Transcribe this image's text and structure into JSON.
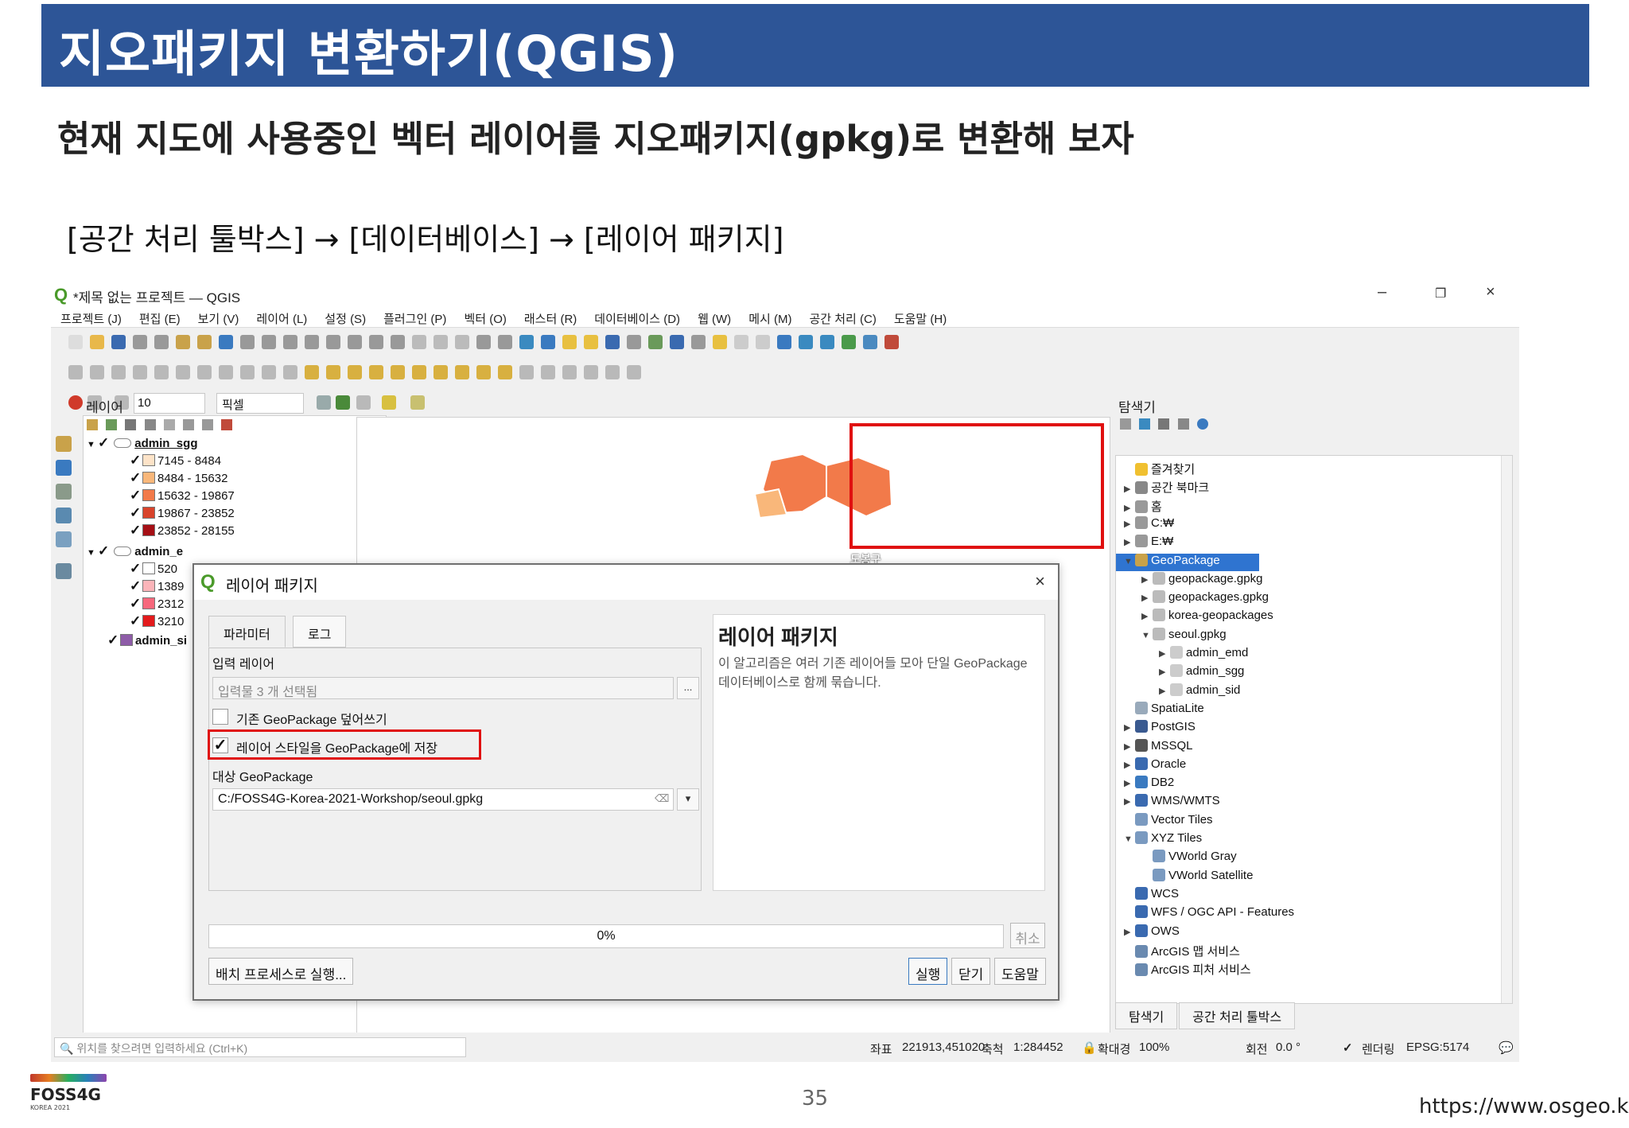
{
  "slide": {
    "title": "지오패키지 변환하기(QGIS)",
    "subtitle": "현재 지도에 사용중인 벡터 레이어를 지오패키지(gpkg)로 변환해 보자",
    "path": "[공간 처리 툴박스] → [데이터베이스] → [레이어 패키지]",
    "page_number": "35",
    "footer_url": "https://www.osgeo.kr",
    "logo_name": "FOSS4G",
    "logo_sub": "KOREA 2021"
  },
  "qgis": {
    "window_title": "*제목 없는 프로젝트 — QGIS",
    "window_controls": {
      "minimize": "–",
      "restore": "❐",
      "close": "×"
    },
    "menu": [
      "프로젝트 (J)",
      "편집 (E)",
      "보기 (V)",
      "레이어 (L)",
      "설정 (S)",
      "플러그인 (P)",
      "벡터 (O)",
      "래스터 (R)",
      "데이터베이스 (D)",
      "웹 (W)",
      "메시 (M)",
      "공간 처리 (C)",
      "도움말 (H)"
    ],
    "snapping": {
      "tolerance": "10",
      "unit": "픽셀"
    },
    "layers_panel": {
      "title": "레이어",
      "items": [
        {
          "name": "admin_sgg",
          "checked": true
        },
        {
          "label": "7145 - 8484",
          "color": "#fde3c8"
        },
        {
          "label": "8484 - 15632",
          "color": "#f9b77a"
        },
        {
          "label": "15632 - 19867",
          "color": "#f27a4a"
        },
        {
          "label": "19867 - 23852",
          "color": "#d8432b"
        },
        {
          "label": "23852 - 28155",
          "color": "#a50f15"
        },
        {
          "name": "admin_e",
          "checked": true
        },
        {
          "label": "520",
          "color": "#ffffff"
        },
        {
          "label": "1389",
          "color": "#fbb4b9"
        },
        {
          "label": "2312",
          "color": "#f7687c"
        },
        {
          "label": "3210",
          "color": "#e31a1c"
        },
        {
          "name": "admin_si",
          "checked": true,
          "color": "#8e5ca8"
        }
      ]
    },
    "map": {
      "label": "도봉구"
    },
    "browser_panel": {
      "title": "탐색기",
      "items": [
        {
          "label": "즐겨찾기",
          "icon": "star-icon"
        },
        {
          "label": "공간 북마크",
          "icon": "bookmark-icon"
        },
        {
          "label": "홈",
          "icon": "home-icon"
        },
        {
          "label": "C:₩",
          "icon": "drive-icon"
        },
        {
          "label": "E:₩",
          "icon": "drive-icon"
        },
        {
          "label": "GeoPackage",
          "icon": "geopackage-icon",
          "selected": true
        },
        {
          "label": "geopackage.gpkg",
          "icon": "database-icon"
        },
        {
          "label": "geopackages.gpkg",
          "icon": "database-icon"
        },
        {
          "label": "korea-geopackages",
          "icon": "database-icon"
        },
        {
          "label": "seoul.gpkg",
          "icon": "database-icon"
        },
        {
          "label": "admin_emd",
          "icon": "polygon-layer-icon"
        },
        {
          "label": "admin_sgg",
          "icon": "polygon-layer-icon"
        },
        {
          "label": "admin_sid",
          "icon": "polygon-layer-icon"
        },
        {
          "label": "SpatiaLite",
          "icon": "spatialite-icon"
        },
        {
          "label": "PostGIS",
          "icon": "postgis-icon"
        },
        {
          "label": "MSSQL",
          "icon": "mssql-icon"
        },
        {
          "label": "Oracle",
          "icon": "oracle-icon"
        },
        {
          "label": "DB2",
          "icon": "db2-icon"
        },
        {
          "label": "WMS/WMTS",
          "icon": "globe-icon"
        },
        {
          "label": "Vector Tiles",
          "icon": "grid-icon"
        },
        {
          "label": "XYZ Tiles",
          "icon": "grid-icon"
        },
        {
          "label": "VWorld Gray",
          "icon": "grid-icon"
        },
        {
          "label": "VWorld Satellite",
          "icon": "grid-icon"
        },
        {
          "label": "WCS",
          "icon": "globe-icon"
        },
        {
          "label": "WFS / OGC API - Features",
          "icon": "globe-icon"
        },
        {
          "label": "OWS",
          "icon": "globe-icon"
        },
        {
          "label": "ArcGIS 맵 서비스",
          "icon": "arcgis-icon"
        },
        {
          "label": "ArcGIS 피처 서비스",
          "icon": "arcgis-icon"
        }
      ],
      "tabs": [
        "탐색기",
        "공간 처리 툴박스"
      ]
    },
    "statusbar": {
      "locator_placeholder": "위치를 찾으려면 입력하세요 (Ctrl+K)",
      "coord_label": "좌표",
      "coord_value": "221913,451020",
      "scale_label": "축척",
      "scale_value": "1:284452",
      "magnifier_label": "확대경",
      "magnifier_value": "100%",
      "rotation_label": "회전",
      "rotation_value": "0.0 °",
      "render_label": "렌더링",
      "crs": "EPSG:5174"
    }
  },
  "dialog": {
    "title": "레이어 패키지",
    "close": "×",
    "tabs": [
      "파라미터",
      "로그"
    ],
    "input_layers_label": "입력 레이어",
    "input_layers_value": "입력물 3 개 선택됨",
    "browse_button": "...",
    "overwrite_label": "기존 GeoPackage 덮어쓰기",
    "overwrite_checked": false,
    "save_styles_label": "레이어 스타일을 GeoPackage에 저장",
    "save_styles_checked": true,
    "dest_label": "대상 GeoPackage",
    "dest_value": "C:/FOSS4G-Korea-2021-Workshop/seoul.gpkg",
    "help_title": "레이어 패키지",
    "help_text": "이 알고리즘은 여러 기존 레이어들 모아 단일 GeoPackage 데이터베이스로 함께 묶습니다.",
    "progress": "0%",
    "progress_value": 0,
    "cancel_button": "취소",
    "batch_button": "배치 프로세스로 실행...",
    "run_button": "실행",
    "close_button": "닫기",
    "help_button": "도움말"
  }
}
